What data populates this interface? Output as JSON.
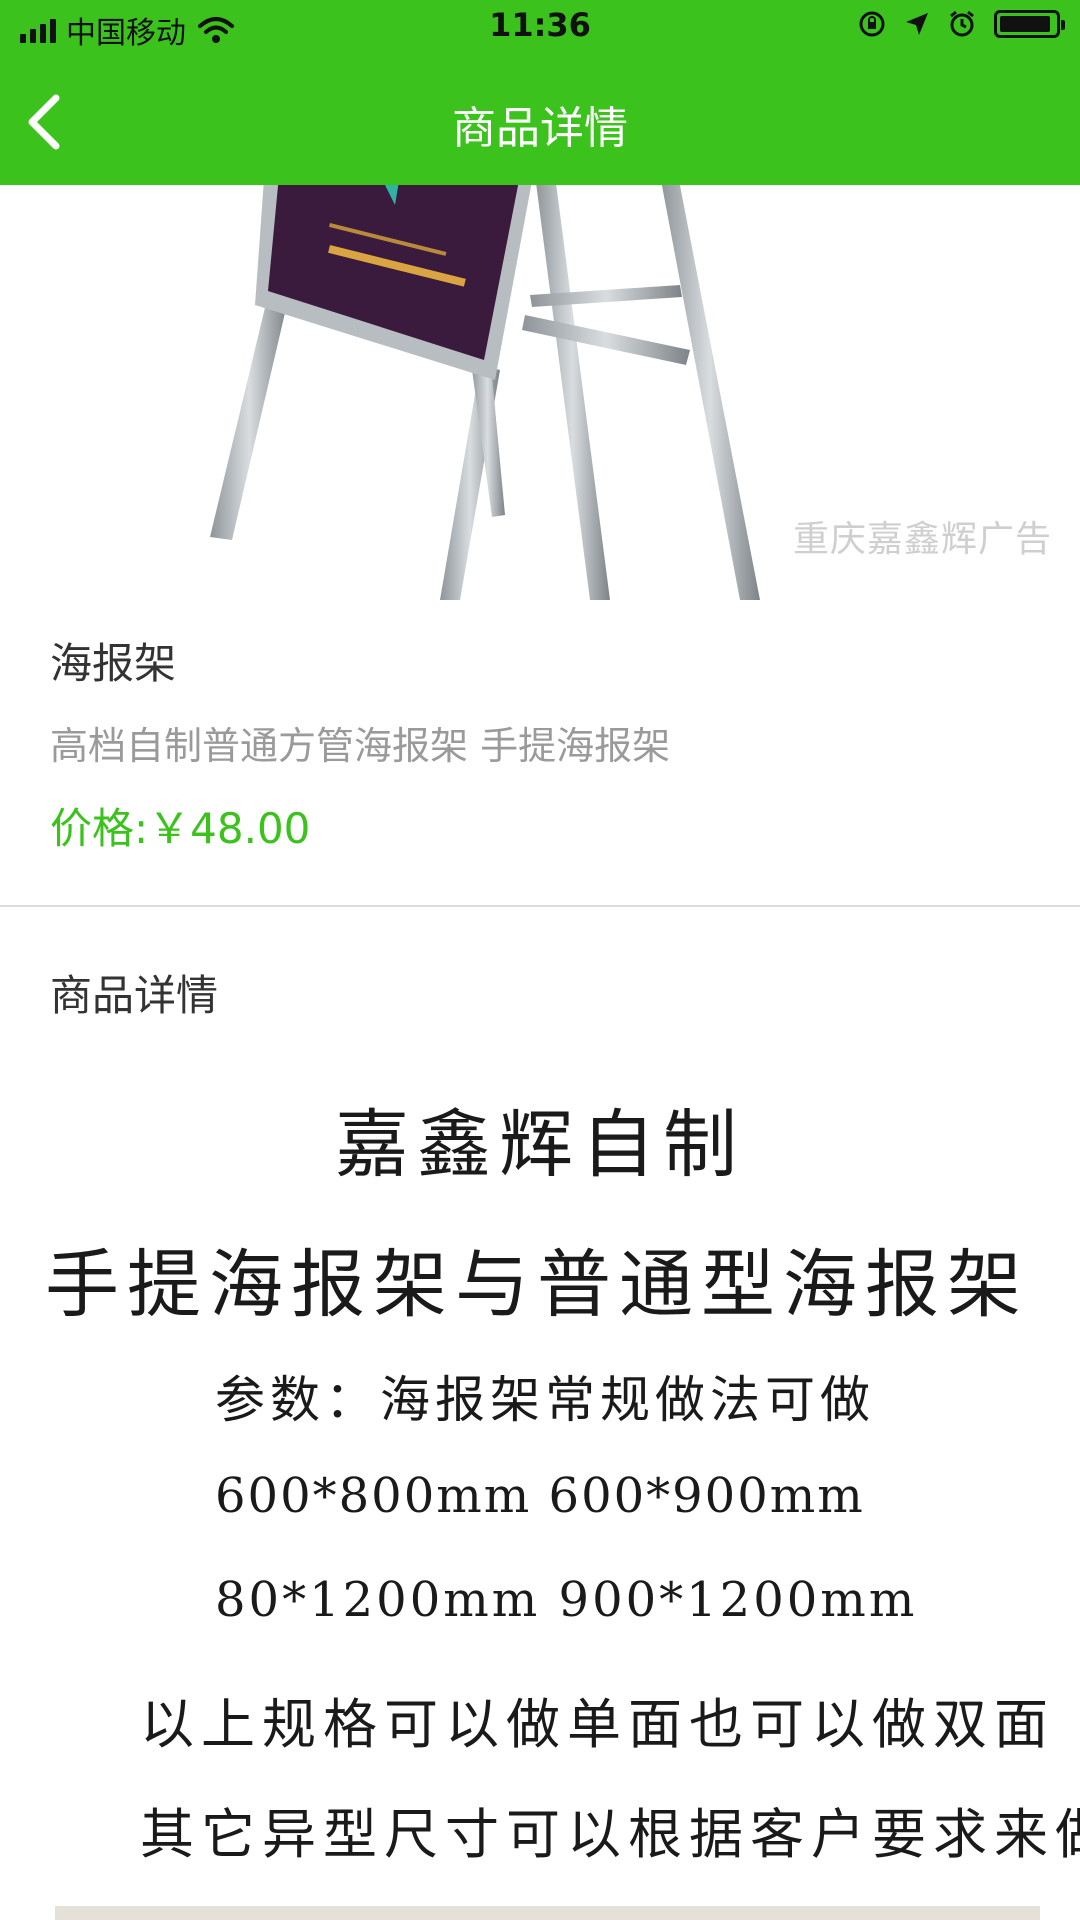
{
  "status_bar": {
    "carrier": "中国移动",
    "time": "11:36"
  },
  "nav": {
    "title": "商品详情",
    "back_icon": "chevron-left-icon"
  },
  "product_image": {
    "watermark": "重庆嘉鑫辉广告",
    "poster_color": "#3a1b3d"
  },
  "product": {
    "name": "海报架",
    "description": "高档自制普通方管海报架 手提海报架",
    "price": "价格:￥48.00"
  },
  "detail": {
    "label": "商品详情",
    "lines": [
      "嘉鑫辉自制",
      "手提海报架与普通型海报架",
      "参数：海报架常规做法可做",
      "600*800mm   600*900mm",
      "80*1200mm    900*1200mm",
      "以上规格可以做单面也可以做双面",
      "其它异型尺寸可以根据客户要求来做"
    ]
  },
  "colors": {
    "brand": "#3bc21d",
    "text": "#333333",
    "muted": "#9a9a9a"
  }
}
